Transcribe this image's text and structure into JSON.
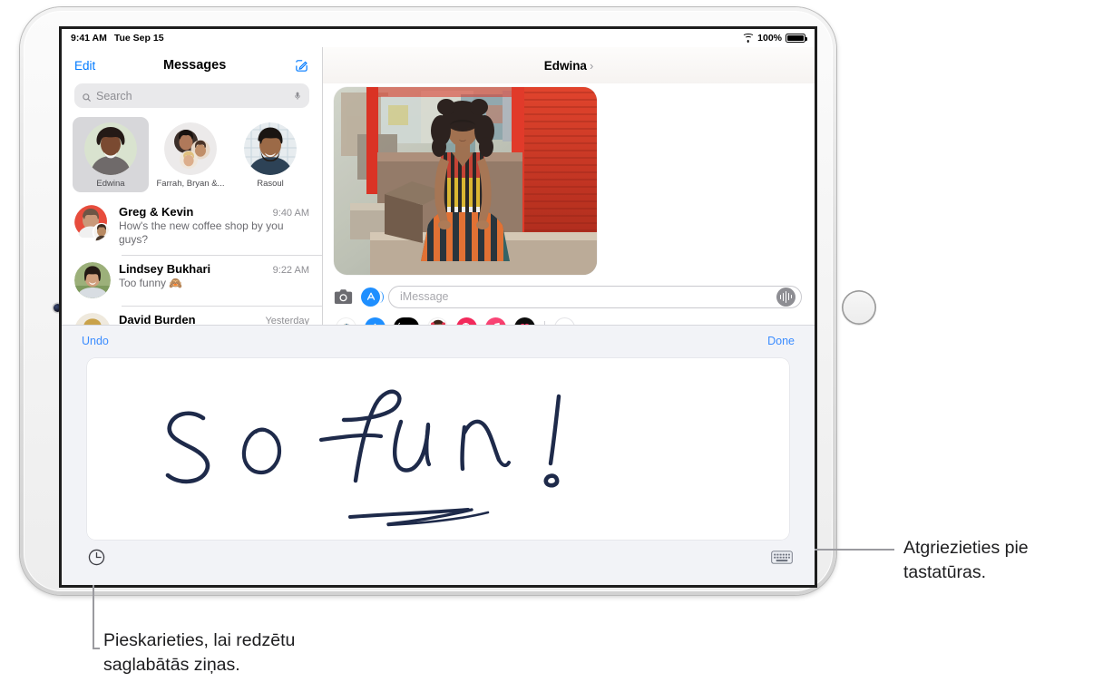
{
  "device": {
    "name": "ipad"
  },
  "status_bar": {
    "time": "9:41 AM",
    "date": "Tue Sep 15",
    "wifi_icon": "wifi-icon",
    "battery_percent": "100%",
    "battery_icon": "battery-full-icon"
  },
  "sidebar": {
    "edit_label": "Edit",
    "title": "Messages",
    "compose_icon": "compose-icon",
    "search": {
      "placeholder": "Search",
      "search_icon": "search-icon",
      "dictation_icon": "microphone-icon"
    },
    "pinned": [
      {
        "name": "Edwina",
        "selected": true
      },
      {
        "name": "Farrah, Bryan &...",
        "selected": false
      },
      {
        "name": "Rasoul",
        "selected": false
      }
    ],
    "conversations": [
      {
        "name": "Greg & Kevin",
        "time": "9:40 AM",
        "preview": "How's the new coffee shop by you guys?"
      },
      {
        "name": "Lindsey Bukhari",
        "time": "9:22 AM",
        "preview": "Too funny 🙈"
      },
      {
        "name": "David Burden",
        "time": "Yesterday",
        "preview": ""
      }
    ]
  },
  "conversation": {
    "title": "Edwina",
    "detail_chevron": "›",
    "photo_message": {
      "alt": "photo-message-bubble"
    },
    "input": {
      "camera_icon": "camera-icon",
      "appstore_icon": "app-store-icon",
      "placeholder": "iMessage",
      "audio_icon": "audio-message-icon"
    },
    "app_drawer": [
      {
        "id": "photos-icon",
        "label": "Photos"
      },
      {
        "id": "app-store-icon",
        "label": "App Store"
      },
      {
        "id": "apple-pay-icon",
        "label": "Apple Pay"
      },
      {
        "id": "memoji-icon",
        "label": "Memoji Stickers"
      },
      {
        "id": "digital-touch-icon",
        "label": "#images"
      },
      {
        "id": "music-icon",
        "label": "Music"
      },
      {
        "id": "digital-touch-heart-icon",
        "label": "Digital Touch"
      },
      {
        "id": "more-icon",
        "label": "More"
      }
    ]
  },
  "handwriting_sheet": {
    "undo_label": "Undo",
    "done_label": "Done",
    "written_text": "So fun!",
    "recents_icon": "clock-icon",
    "keyboard_icon": "keyboard-icon"
  },
  "callouts": [
    {
      "id": "callout-keyboard",
      "text": "Atgriezieties pie tastatūras.",
      "line1": "Atgriezieties pie",
      "line2": "tastatūras."
    },
    {
      "id": "callout-recents",
      "text": "Pieskarieties, lai redzētu saglabātās ziņas.",
      "line1": "Pieskarieties, lai redzētu",
      "line2": "saglabātās ziņas."
    }
  ],
  "colors": {
    "accent_blue": "#007aff",
    "sheet_blue": "#3b8cff",
    "ink": "#1e2a4a",
    "sheet_bg": "#f2f3f7",
    "secondary_text": "#8e8e93"
  }
}
